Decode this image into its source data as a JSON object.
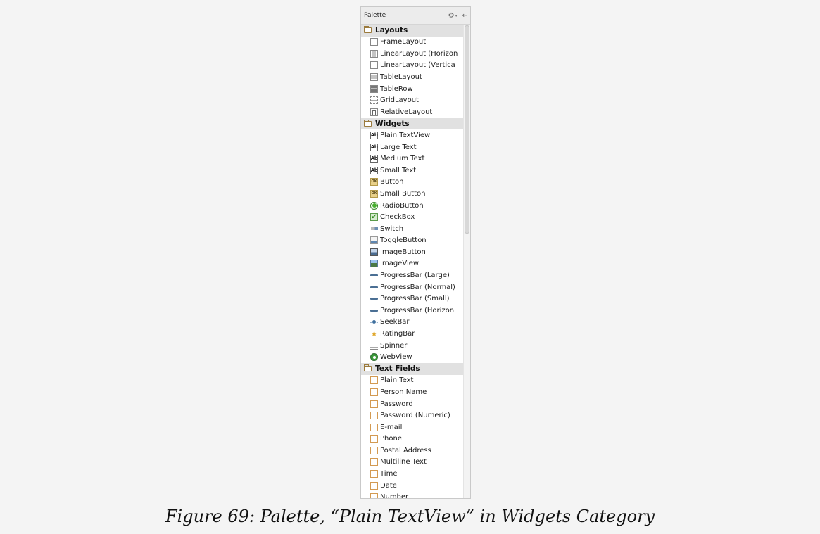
{
  "palette": {
    "title": "Palette",
    "categories": [
      {
        "name": "Layouts",
        "items": [
          {
            "label": "FrameLayout",
            "icon": "frame-layout-icon"
          },
          {
            "label": "LinearLayout (Horizon",
            "icon": "linear-layout-horizontal-icon"
          },
          {
            "label": "LinearLayout (Vertica",
            "icon": "linear-layout-vertical-icon"
          },
          {
            "label": "TableLayout",
            "icon": "table-layout-icon"
          },
          {
            "label": "TableRow",
            "icon": "table-row-icon"
          },
          {
            "label": "GridLayout",
            "icon": "grid-layout-icon"
          },
          {
            "label": "RelativeLayout",
            "icon": "relative-layout-icon"
          }
        ]
      },
      {
        "name": "Widgets",
        "items": [
          {
            "label": "Plain TextView",
            "icon": "textview-icon"
          },
          {
            "label": "Large Text",
            "icon": "textview-icon"
          },
          {
            "label": "Medium Text",
            "icon": "textview-icon"
          },
          {
            "label": "Small Text",
            "icon": "textview-icon"
          },
          {
            "label": "Button",
            "icon": "button-icon"
          },
          {
            "label": "Small Button",
            "icon": "button-icon"
          },
          {
            "label": "RadioButton",
            "icon": "radio-button-icon"
          },
          {
            "label": "CheckBox",
            "icon": "checkbox-icon"
          },
          {
            "label": "Switch",
            "icon": "switch-icon"
          },
          {
            "label": "ToggleButton",
            "icon": "toggle-button-icon"
          },
          {
            "label": "ImageButton",
            "icon": "image-button-icon"
          },
          {
            "label": "ImageView",
            "icon": "image-view-icon"
          },
          {
            "label": "ProgressBar (Large)",
            "icon": "progress-bar-icon"
          },
          {
            "label": "ProgressBar (Normal)",
            "icon": "progress-bar-icon"
          },
          {
            "label": "ProgressBar (Small)",
            "icon": "progress-bar-icon"
          },
          {
            "label": "ProgressBar (Horizon",
            "icon": "progress-bar-icon"
          },
          {
            "label": "SeekBar",
            "icon": "seekbar-icon"
          },
          {
            "label": "RatingBar",
            "icon": "rating-bar-icon"
          },
          {
            "label": "Spinner",
            "icon": "spinner-icon"
          },
          {
            "label": "WebView",
            "icon": "webview-icon"
          }
        ]
      },
      {
        "name": "Text Fields",
        "items": [
          {
            "label": "Plain Text",
            "icon": "text-field-icon"
          },
          {
            "label": "Person Name",
            "icon": "text-field-icon"
          },
          {
            "label": "Password",
            "icon": "text-field-icon"
          },
          {
            "label": "Password (Numeric)",
            "icon": "text-field-icon"
          },
          {
            "label": "E-mail",
            "icon": "text-field-icon"
          },
          {
            "label": "Phone",
            "icon": "text-field-icon"
          },
          {
            "label": "Postal Address",
            "icon": "text-field-icon"
          },
          {
            "label": "Multiline Text",
            "icon": "text-field-icon"
          },
          {
            "label": "Time",
            "icon": "text-field-icon"
          },
          {
            "label": "Date",
            "icon": "text-field-icon"
          },
          {
            "label": "Number",
            "icon": "text-field-icon"
          }
        ]
      }
    ]
  },
  "caption": "Figure 69: Palette, “Plain TextView” in Widgets Category"
}
